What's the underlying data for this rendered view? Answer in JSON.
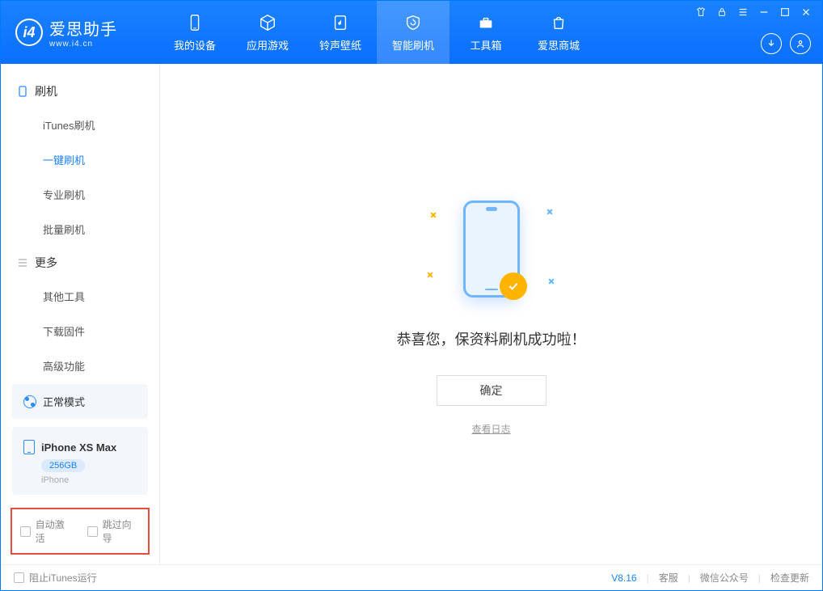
{
  "brand": {
    "title": "爱思助手",
    "subtitle": "www.i4.cn"
  },
  "header_tabs": [
    {
      "label": "我的设备"
    },
    {
      "label": "应用游戏"
    },
    {
      "label": "铃声壁纸"
    },
    {
      "label": "智能刷机"
    },
    {
      "label": "工具箱"
    },
    {
      "label": "爱思商城"
    }
  ],
  "sidebar": {
    "group1": {
      "title": "刷机",
      "items": [
        "iTunes刷机",
        "一键刷机",
        "专业刷机",
        "批量刷机"
      ]
    },
    "group2": {
      "title": "更多",
      "items": [
        "其他工具",
        "下载固件",
        "高级功能"
      ]
    }
  },
  "device": {
    "mode": "正常模式",
    "name": "iPhone XS Max",
    "capacity": "256GB",
    "type": "iPhone"
  },
  "options": {
    "auto_activate": "自动激活",
    "skip_guide": "跳过向导"
  },
  "main": {
    "success_msg": "恭喜您，保资料刷机成功啦！",
    "ok_btn": "确定",
    "view_log": "查看日志"
  },
  "footer": {
    "block_itunes": "阻止iTunes运行",
    "version": "V8.16",
    "links": [
      "客服",
      "微信公众号",
      "检查更新"
    ]
  }
}
